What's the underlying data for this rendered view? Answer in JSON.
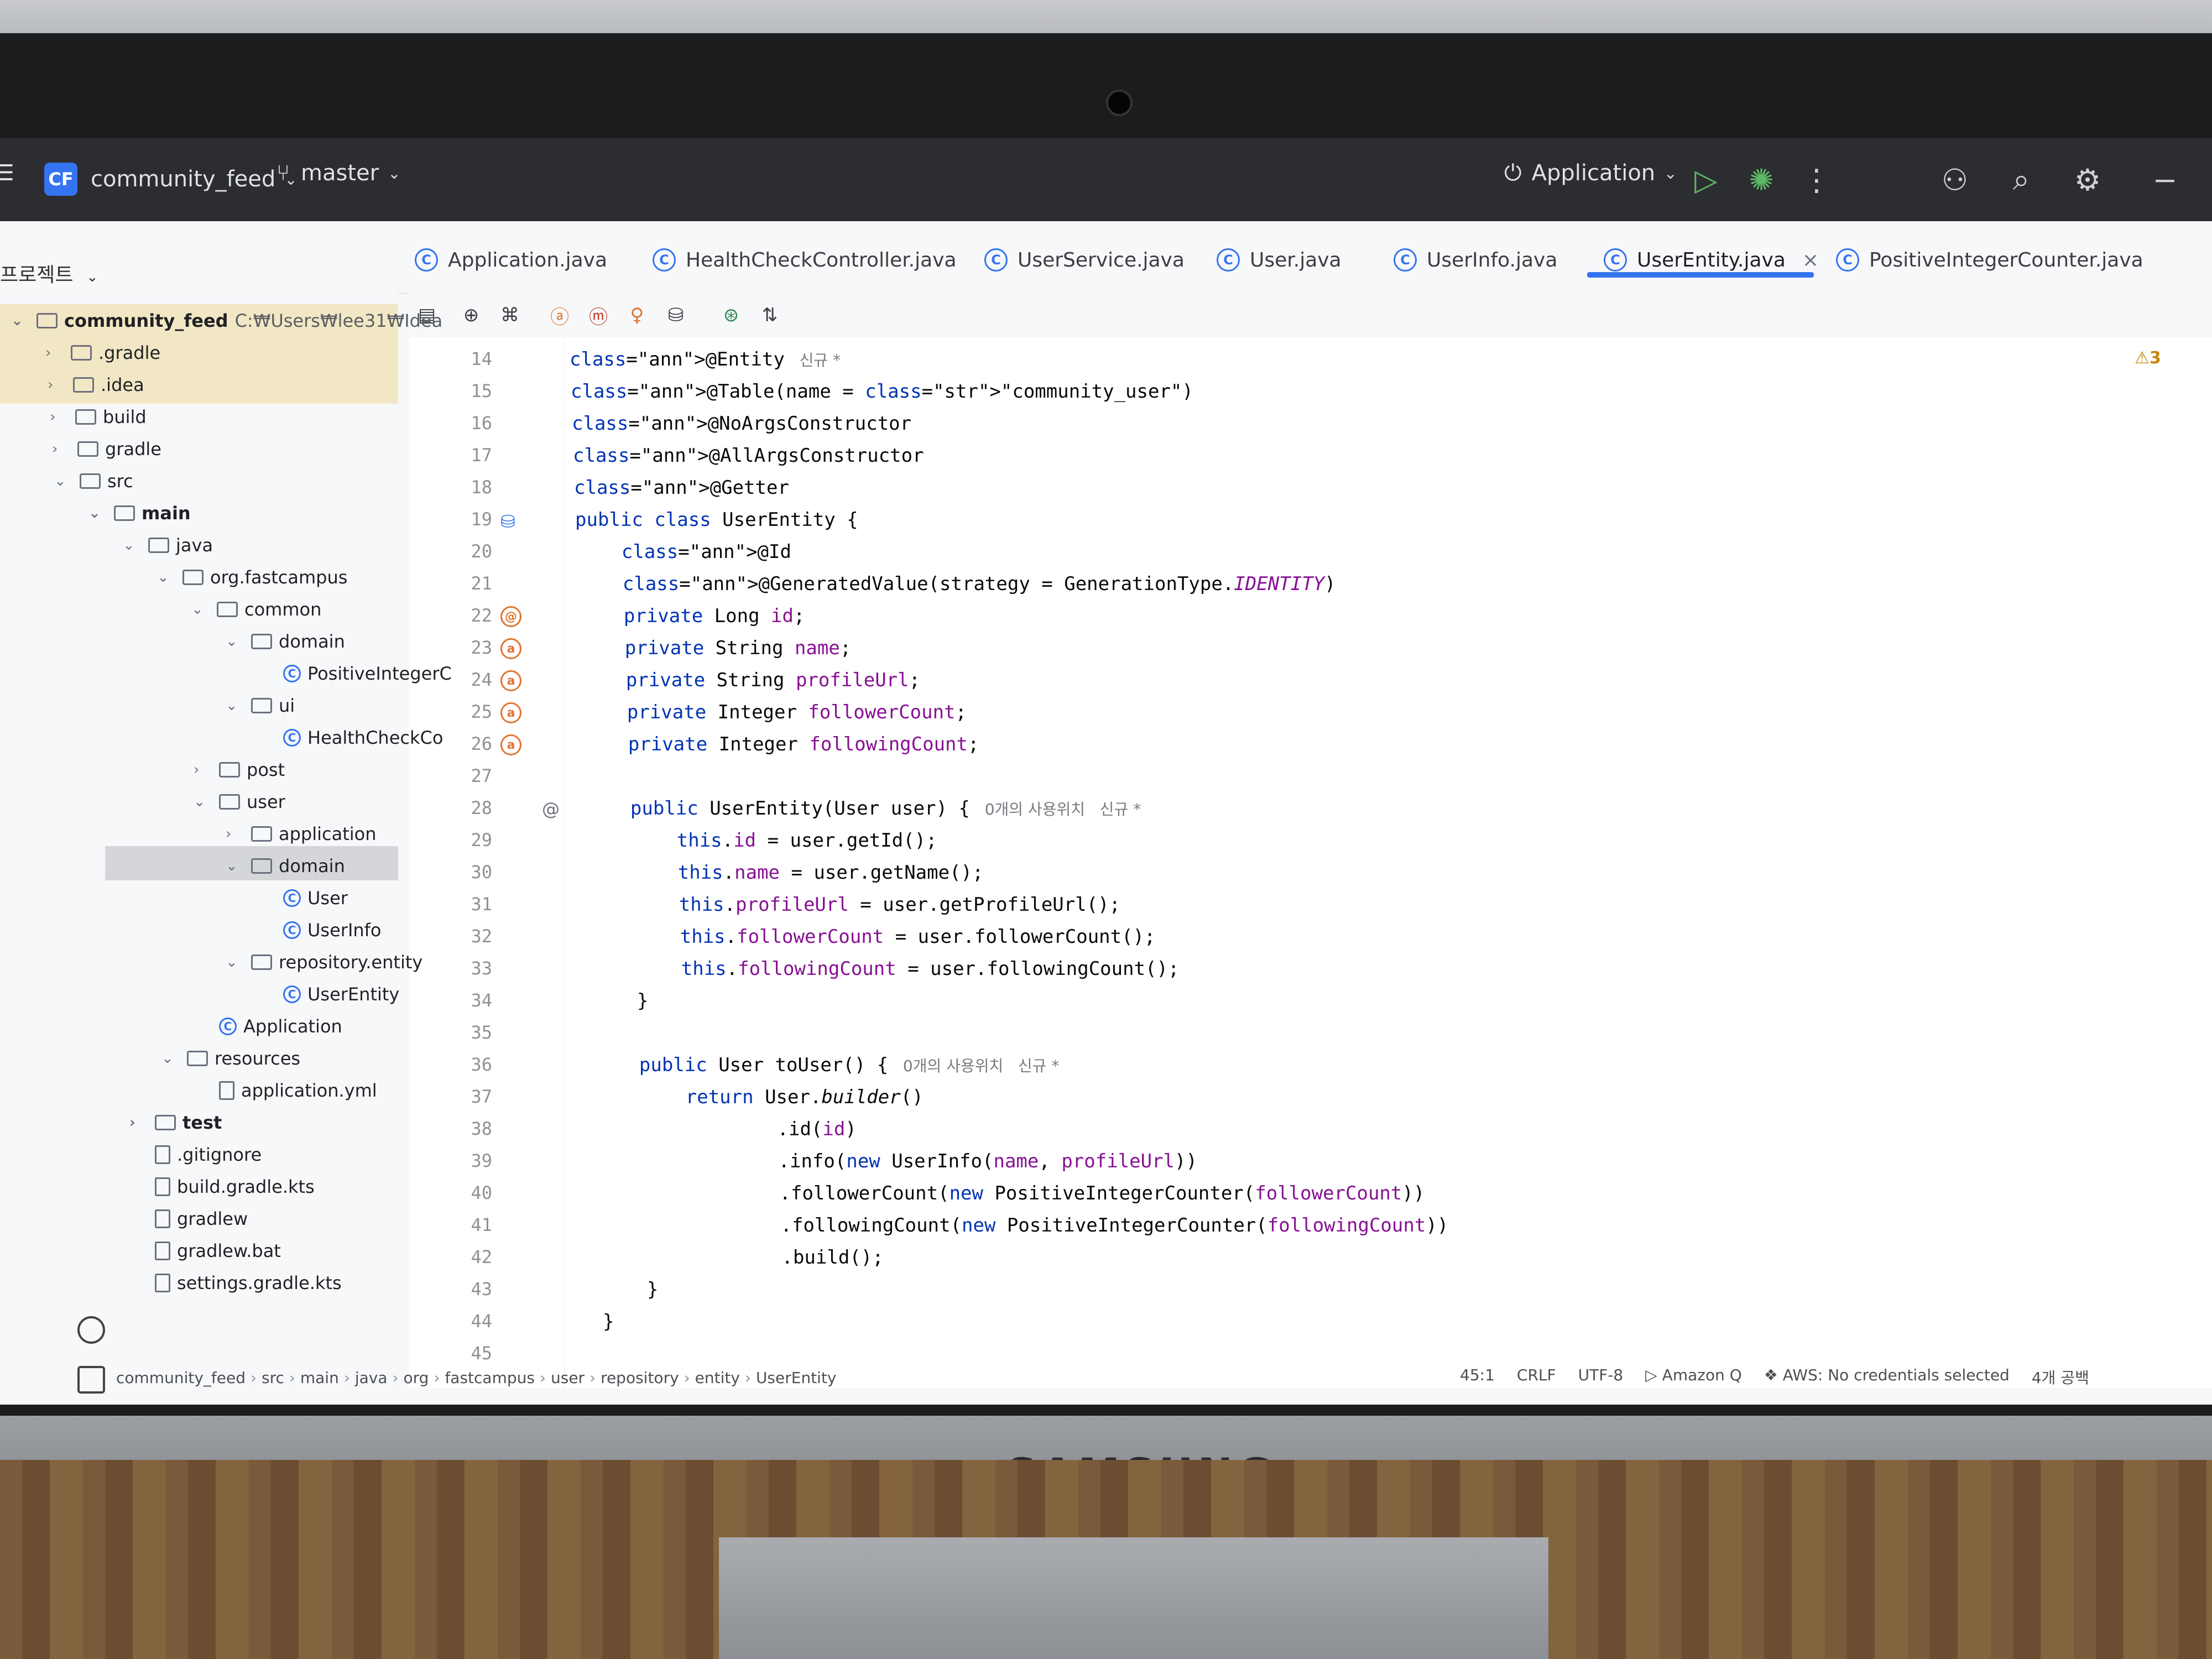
{
  "titlebar": {
    "project_badge": "CF",
    "project_name": "community_feed",
    "branch": "master",
    "run_config": "Application",
    "icons": [
      "run-icon",
      "debug-icon",
      "more-icon",
      "add-user-icon",
      "search-icon",
      "settings-icon",
      "minimize-icon"
    ]
  },
  "tabs": [
    {
      "label": "Application.java"
    },
    {
      "label": "HealthCheckController.java"
    },
    {
      "label": "UserService.java"
    },
    {
      "label": "User.java"
    },
    {
      "label": "UserInfo.java"
    },
    {
      "label": "UserEntity.java",
      "active": true,
      "close": "×"
    },
    {
      "label": "PositiveIntegerCounter.java"
    }
  ],
  "project_panel": {
    "header": "프로젝트",
    "tree": [
      {
        "label": "community_feed",
        "suffix": "C:₩Users₩lee31₩Idea"
      },
      {
        "label": ".gradle"
      },
      {
        "label": ".idea"
      },
      {
        "label": "build"
      },
      {
        "label": "gradle"
      },
      {
        "label": "src"
      },
      {
        "label": "main"
      },
      {
        "label": "java"
      },
      {
        "label": "org.fastcampus"
      },
      {
        "label": "common"
      },
      {
        "label": "domain"
      },
      {
        "label": "PositiveIntegerC"
      },
      {
        "label": "ui"
      },
      {
        "label": "HealthCheckCo"
      },
      {
        "label": "post"
      },
      {
        "label": "user"
      },
      {
        "label": "application"
      },
      {
        "label": "domain"
      },
      {
        "label": "User"
      },
      {
        "label": "UserInfo"
      },
      {
        "label": "repository.entity"
      },
      {
        "label": "UserEntity"
      },
      {
        "label": "Application"
      },
      {
        "label": "resources"
      },
      {
        "label": "application.yml"
      },
      {
        "label": "test"
      },
      {
        "label": ".gitignore"
      },
      {
        "label": "build.gradle.kts"
      },
      {
        "label": "gradlew"
      },
      {
        "label": "gradlew.bat"
      },
      {
        "label": "settings.gradle.kts"
      }
    ]
  },
  "editor": {
    "warnings": "3",
    "line_numbers": [
      "14",
      "15",
      "16",
      "17",
      "18",
      "19",
      "20",
      "21",
      "22",
      "23",
      "24",
      "25",
      "26",
      "27",
      "28",
      "29",
      "30",
      "31",
      "32",
      "33",
      "34",
      "35",
      "36",
      "37",
      "38",
      "39",
      "40",
      "41",
      "42",
      "43",
      "44",
      "45"
    ],
    "lines": [
      {
        "t": "@Entity",
        "hint": "신규 *"
      },
      {
        "t": "@Table(name = \"community_user\")"
      },
      {
        "t": "@NoArgsConstructor"
      },
      {
        "t": "@AllArgsConstructor"
      },
      {
        "t": "@Getter"
      },
      {
        "t": "public class UserEntity {"
      },
      {
        "t": "    @Id"
      },
      {
        "t": "    @GeneratedValue(strategy = GenerationType.IDENTITY)"
      },
      {
        "t": "    private Long id;"
      },
      {
        "t": "    private String name;"
      },
      {
        "t": "    private String profileUrl;"
      },
      {
        "t": "    private Integer followerCount;"
      },
      {
        "t": "    private Integer followingCount;"
      },
      {
        "t": ""
      },
      {
        "t": "    public UserEntity(User user) {",
        "hint": "0개의 사용위치   신규 *"
      },
      {
        "t": "        this.id = user.getId();"
      },
      {
        "t": "        this.name = user.getName();"
      },
      {
        "t": "        this.profileUrl = user.getProfileUrl();"
      },
      {
        "t": "        this.followerCount = user.followerCount();"
      },
      {
        "t": "        this.followingCount = user.followingCount();"
      },
      {
        "t": "    }"
      },
      {
        "t": ""
      },
      {
        "t": "    public User toUser() {",
        "hint": "0개의 사용위치   신규 *"
      },
      {
        "t": "        return User.builder()"
      },
      {
        "t": "                .id(id)"
      },
      {
        "t": "                .info(new UserInfo(name, profileUrl))"
      },
      {
        "t": "                .followerCount(new PositiveIntegerCounter(followerCount))"
      },
      {
        "t": "                .followingCount(new PositiveIntegerCounter(followingCount))"
      },
      {
        "t": "                .build();"
      },
      {
        "t": "    }"
      },
      {
        "t": "}"
      },
      {
        "t": ""
      }
    ]
  },
  "statusbar": {
    "breadcrumbs": [
      "community_feed",
      "src",
      "main",
      "java",
      "org",
      "fastcampus",
      "user",
      "repository",
      "entity",
      "UserEntity"
    ],
    "position": "45:1",
    "line_sep": "CRLF",
    "encoding": "UTF-8",
    "plugin": "Amazon Q",
    "aws": "AWS: No credentials selected",
    "indent": "4개 공백"
  },
  "hardware": {
    "brand": "SAMSUNG"
  }
}
